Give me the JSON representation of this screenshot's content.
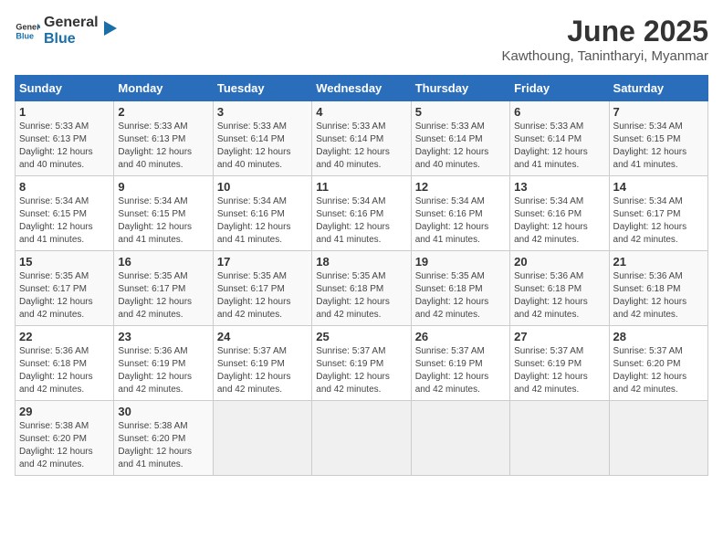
{
  "header": {
    "logo_general": "General",
    "logo_blue": "Blue",
    "title": "June 2025",
    "subtitle": "Kawthoung, Tanintharyi, Myanmar"
  },
  "calendar": {
    "days_of_week": [
      "Sunday",
      "Monday",
      "Tuesday",
      "Wednesday",
      "Thursday",
      "Friday",
      "Saturday"
    ],
    "weeks": [
      [
        {
          "day": "",
          "empty": true
        },
        {
          "day": "",
          "empty": true
        },
        {
          "day": "",
          "empty": true
        },
        {
          "day": "",
          "empty": true
        },
        {
          "day": "",
          "empty": true
        },
        {
          "day": "",
          "empty": true
        },
        {
          "day": "",
          "empty": true
        }
      ]
    ],
    "cells": [
      [
        {
          "num": "",
          "info": ""
        },
        {
          "num": "",
          "info": ""
        },
        {
          "num": "",
          "info": ""
        },
        {
          "num": "",
          "info": ""
        },
        {
          "num": "",
          "info": ""
        },
        {
          "num": "",
          "info": ""
        },
        {
          "num": "",
          "info": ""
        }
      ]
    ]
  },
  "weeks": [
    {
      "row": [
        {
          "num": "1",
          "sunrise": "Sunrise: 5:33 AM",
          "sunset": "Sunset: 6:13 PM",
          "daylight": "Daylight: 12 hours and 40 minutes."
        },
        {
          "num": "2",
          "sunrise": "Sunrise: 5:33 AM",
          "sunset": "Sunset: 6:13 PM",
          "daylight": "Daylight: 12 hours and 40 minutes."
        },
        {
          "num": "3",
          "sunrise": "Sunrise: 5:33 AM",
          "sunset": "Sunset: 6:14 PM",
          "daylight": "Daylight: 12 hours and 40 minutes."
        },
        {
          "num": "4",
          "sunrise": "Sunrise: 5:33 AM",
          "sunset": "Sunset: 6:14 PM",
          "daylight": "Daylight: 12 hours and 40 minutes."
        },
        {
          "num": "5",
          "sunrise": "Sunrise: 5:33 AM",
          "sunset": "Sunset: 6:14 PM",
          "daylight": "Daylight: 12 hours and 40 minutes."
        },
        {
          "num": "6",
          "sunrise": "Sunrise: 5:33 AM",
          "sunset": "Sunset: 6:14 PM",
          "daylight": "Daylight: 12 hours and 41 minutes."
        },
        {
          "num": "7",
          "sunrise": "Sunrise: 5:34 AM",
          "sunset": "Sunset: 6:15 PM",
          "daylight": "Daylight: 12 hours and 41 minutes."
        }
      ],
      "prefix_empty": 0
    },
    {
      "row": [
        {
          "num": "8",
          "sunrise": "Sunrise: 5:34 AM",
          "sunset": "Sunset: 6:15 PM",
          "daylight": "Daylight: 12 hours and 41 minutes."
        },
        {
          "num": "9",
          "sunrise": "Sunrise: 5:34 AM",
          "sunset": "Sunset: 6:15 PM",
          "daylight": "Daylight: 12 hours and 41 minutes."
        },
        {
          "num": "10",
          "sunrise": "Sunrise: 5:34 AM",
          "sunset": "Sunset: 6:16 PM",
          "daylight": "Daylight: 12 hours and 41 minutes."
        },
        {
          "num": "11",
          "sunrise": "Sunrise: 5:34 AM",
          "sunset": "Sunset: 6:16 PM",
          "daylight": "Daylight: 12 hours and 41 minutes."
        },
        {
          "num": "12",
          "sunrise": "Sunrise: 5:34 AM",
          "sunset": "Sunset: 6:16 PM",
          "daylight": "Daylight: 12 hours and 41 minutes."
        },
        {
          "num": "13",
          "sunrise": "Sunrise: 5:34 AM",
          "sunset": "Sunset: 6:16 PM",
          "daylight": "Daylight: 12 hours and 42 minutes."
        },
        {
          "num": "14",
          "sunrise": "Sunrise: 5:34 AM",
          "sunset": "Sunset: 6:17 PM",
          "daylight": "Daylight: 12 hours and 42 minutes."
        }
      ],
      "prefix_empty": 0
    },
    {
      "row": [
        {
          "num": "15",
          "sunrise": "Sunrise: 5:35 AM",
          "sunset": "Sunset: 6:17 PM",
          "daylight": "Daylight: 12 hours and 42 minutes."
        },
        {
          "num": "16",
          "sunrise": "Sunrise: 5:35 AM",
          "sunset": "Sunset: 6:17 PM",
          "daylight": "Daylight: 12 hours and 42 minutes."
        },
        {
          "num": "17",
          "sunrise": "Sunrise: 5:35 AM",
          "sunset": "Sunset: 6:17 PM",
          "daylight": "Daylight: 12 hours and 42 minutes."
        },
        {
          "num": "18",
          "sunrise": "Sunrise: 5:35 AM",
          "sunset": "Sunset: 6:18 PM",
          "daylight": "Daylight: 12 hours and 42 minutes."
        },
        {
          "num": "19",
          "sunrise": "Sunrise: 5:35 AM",
          "sunset": "Sunset: 6:18 PM",
          "daylight": "Daylight: 12 hours and 42 minutes."
        },
        {
          "num": "20",
          "sunrise": "Sunrise: 5:36 AM",
          "sunset": "Sunset: 6:18 PM",
          "daylight": "Daylight: 12 hours and 42 minutes."
        },
        {
          "num": "21",
          "sunrise": "Sunrise: 5:36 AM",
          "sunset": "Sunset: 6:18 PM",
          "daylight": "Daylight: 12 hours and 42 minutes."
        }
      ],
      "prefix_empty": 0
    },
    {
      "row": [
        {
          "num": "22",
          "sunrise": "Sunrise: 5:36 AM",
          "sunset": "Sunset: 6:18 PM",
          "daylight": "Daylight: 12 hours and 42 minutes."
        },
        {
          "num": "23",
          "sunrise": "Sunrise: 5:36 AM",
          "sunset": "Sunset: 6:19 PM",
          "daylight": "Daylight: 12 hours and 42 minutes."
        },
        {
          "num": "24",
          "sunrise": "Sunrise: 5:37 AM",
          "sunset": "Sunset: 6:19 PM",
          "daylight": "Daylight: 12 hours and 42 minutes."
        },
        {
          "num": "25",
          "sunrise": "Sunrise: 5:37 AM",
          "sunset": "Sunset: 6:19 PM",
          "daylight": "Daylight: 12 hours and 42 minutes."
        },
        {
          "num": "26",
          "sunrise": "Sunrise: 5:37 AM",
          "sunset": "Sunset: 6:19 PM",
          "daylight": "Daylight: 12 hours and 42 minutes."
        },
        {
          "num": "27",
          "sunrise": "Sunrise: 5:37 AM",
          "sunset": "Sunset: 6:19 PM",
          "daylight": "Daylight: 12 hours and 42 minutes."
        },
        {
          "num": "28",
          "sunrise": "Sunrise: 5:37 AM",
          "sunset": "Sunset: 6:20 PM",
          "daylight": "Daylight: 12 hours and 42 minutes."
        }
      ],
      "prefix_empty": 0
    },
    {
      "row": [
        {
          "num": "29",
          "sunrise": "Sunrise: 5:38 AM",
          "sunset": "Sunset: 6:20 PM",
          "daylight": "Daylight: 12 hours and 42 minutes."
        },
        {
          "num": "30",
          "sunrise": "Sunrise: 5:38 AM",
          "sunset": "Sunset: 6:20 PM",
          "daylight": "Daylight: 12 hours and 41 minutes."
        },
        {
          "num": "",
          "empty": true
        },
        {
          "num": "",
          "empty": true
        },
        {
          "num": "",
          "empty": true
        },
        {
          "num": "",
          "empty": true
        },
        {
          "num": "",
          "empty": true
        }
      ],
      "prefix_empty": 0
    }
  ]
}
